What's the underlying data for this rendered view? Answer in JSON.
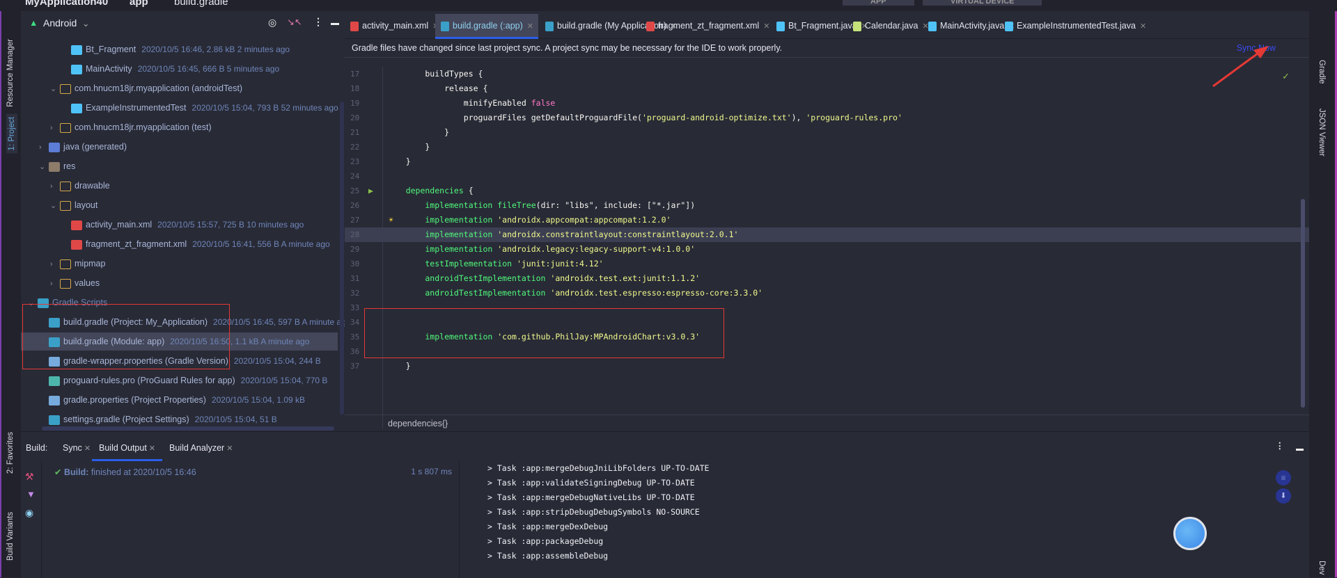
{
  "breadcrumb": [
    "MyApplication40",
    "app",
    "build.gradle"
  ],
  "toolbar": {
    "config": "APP",
    "device": "VIRTUAL DEVICE"
  },
  "left_strip": [
    "Resource Manager",
    "1: Project",
    "2: Favorites",
    "Build Variants"
  ],
  "right_strip": [
    "Gradle",
    "JSON Viewer",
    "Dev"
  ],
  "project": {
    "view": "Android",
    "rows": [
      {
        "level": 4,
        "icon": "java-class",
        "label": "Bt_Fragment",
        "meta": "2020/10/5 16:46, 2.86 kB 2 minutes ago"
      },
      {
        "level": 4,
        "icon": "java-class",
        "label": "MainActivity",
        "meta": "2020/10/5 16:45, 666 B 5 minutes ago"
      },
      {
        "level": 3,
        "arrow": "v",
        "icon": "package",
        "label": "com.hnucm18jr.myapplication (androidTest)",
        "meta": ""
      },
      {
        "level": 4,
        "icon": "test-class",
        "label": "ExampleInstrumentedTest",
        "meta": "2020/10/5 15:04, 793 B 52 minutes ago"
      },
      {
        "level": 3,
        "arrow": ">",
        "icon": "package",
        "label": "com.hnucm18jr.myapplication (test)",
        "meta": ""
      },
      {
        "level": 2,
        "arrow": ">",
        "icon": "generated-folder",
        "label": "java (generated)",
        "meta": ""
      },
      {
        "level": 2,
        "arrow": "v",
        "icon": "res-folder",
        "label": "res",
        "meta": ""
      },
      {
        "level": 3,
        "arrow": ">",
        "icon": "folder",
        "label": "drawable",
        "meta": ""
      },
      {
        "level": 3,
        "arrow": "v",
        "icon": "folder",
        "label": "layout",
        "meta": ""
      },
      {
        "level": 4,
        "icon": "layout-xml",
        "label": "activity_main.xml",
        "meta": "2020/10/5 15:57, 725 B 10 minutes ago"
      },
      {
        "level": 4,
        "icon": "layout-xml",
        "label": "fragment_zt_fragment.xml",
        "meta": "2020/10/5 16:41, 556 B A minute ago"
      },
      {
        "level": 3,
        "arrow": ">",
        "icon": "folder",
        "label": "mipmap",
        "meta": ""
      },
      {
        "level": 3,
        "arrow": ">",
        "icon": "folder",
        "label": "values",
        "meta": ""
      },
      {
        "level": 1,
        "arrow": "v",
        "icon": "gradle",
        "label": "Gradle Scripts",
        "meta": ""
      },
      {
        "level": 2,
        "icon": "gradle",
        "label": "build.gradle (Project: My_Application)",
        "meta": "2020/10/5 16:45, 597 B A minute ago"
      },
      {
        "level": 2,
        "icon": "gradle",
        "label": "build.gradle (Module: app)",
        "meta": "2020/10/5 16:50, 1.1 kB A minute ago",
        "selected": true
      },
      {
        "level": 2,
        "icon": "properties",
        "label": "gradle-wrapper.properties (Gradle Version)",
        "meta": "2020/10/5 15:04, 244 B"
      },
      {
        "level": 2,
        "icon": "proguard",
        "label": "proguard-rules.pro (ProGuard Rules for app)",
        "meta": "2020/10/5 15:04, 770 B"
      },
      {
        "level": 2,
        "icon": "properties",
        "label": "gradle.properties (Project Properties)",
        "meta": "2020/10/5 15:04, 1.09 kB"
      },
      {
        "level": 2,
        "icon": "gradle",
        "label": "settings.gradle (Project Settings)",
        "meta": "2020/10/5 15:04, 51 B"
      }
    ]
  },
  "editor": {
    "tabs": [
      {
        "label": "activity_main.xml",
        "icon": "layout-xml"
      },
      {
        "label": "build.gradle (:app)",
        "icon": "gradle",
        "active": true
      },
      {
        "label": "build.gradle (My Application)",
        "icon": "gradle"
      },
      {
        "label": "fragment_zt_fragment.xml",
        "icon": "layout-xml"
      },
      {
        "label": "Bt_Fragment.java",
        "icon": "java-class"
      },
      {
        "label": "Calendar.java",
        "icon": "java-file"
      },
      {
        "label": "MainActivity.java",
        "icon": "java-class"
      },
      {
        "label": "ExampleInstrumentedTest.java",
        "icon": "test-class"
      }
    ],
    "banner": "Gradle files have changed since last project sync. A project sync may be necessary for the IDE to work properly.",
    "sync_now": "Sync Now",
    "current_line": 28,
    "lines": [
      {
        "n": 17,
        "s": [
          [
            "pl",
            "        buildTypes {"
          ]
        ]
      },
      {
        "n": 18,
        "s": [
          [
            "pl",
            "            release {"
          ]
        ]
      },
      {
        "n": 19,
        "s": [
          [
            "pl",
            "                minifyEnabled "
          ],
          [
            "bool",
            "false"
          ]
        ]
      },
      {
        "n": 20,
        "s": [
          [
            "pl",
            "                proguardFiles getDefaultProguardFile("
          ],
          [
            "str",
            "'proguard-android-optimize.txt'"
          ],
          [
            "pl",
            "), "
          ],
          [
            "str",
            "'proguard-rules.pro'"
          ]
        ]
      },
      {
        "n": 21,
        "s": [
          [
            "pl",
            "            }"
          ]
        ]
      },
      {
        "n": 22,
        "s": [
          [
            "pl",
            "        }"
          ]
        ]
      },
      {
        "n": 23,
        "s": [
          [
            "pl",
            "    }"
          ]
        ]
      },
      {
        "n": 24,
        "s": []
      },
      {
        "n": 25,
        "s": [
          [
            "kw",
            "    dependencies"
          ],
          [
            "pl",
            " {"
          ]
        ]
      },
      {
        "n": 26,
        "s": [
          [
            "kw",
            "        implementation fileTree"
          ],
          [
            "pl",
            "(dir: \"libs\", include: [\"*.jar\"])"
          ]
        ]
      },
      {
        "n": 27,
        "s": [
          [
            "kw",
            "        implementation "
          ],
          [
            "str",
            "'androidx.appcompat:appcompat:1.2.0'"
          ]
        ]
      },
      {
        "n": 28,
        "s": [
          [
            "kw",
            "        implementation "
          ],
          [
            "str",
            "'androidx.constraintlayout:constraintlayout:2.0.1'"
          ]
        ]
      },
      {
        "n": 29,
        "s": [
          [
            "kw",
            "        implementation "
          ],
          [
            "str",
            "'androidx.legacy:legacy-support-v4:1.0.0'"
          ]
        ]
      },
      {
        "n": 30,
        "s": [
          [
            "kw",
            "        testImplementation "
          ],
          [
            "str",
            "'junit:junit:4.12'"
          ]
        ]
      },
      {
        "n": 31,
        "s": [
          [
            "kw",
            "        androidTestImplementation "
          ],
          [
            "str",
            "'androidx.test.ext:junit:1.1.2'"
          ]
        ]
      },
      {
        "n": 32,
        "s": [
          [
            "kw",
            "        androidTestImplementation "
          ],
          [
            "str",
            "'androidx.test.espresso:espresso-core:3.3.0'"
          ]
        ]
      },
      {
        "n": 33,
        "s": []
      },
      {
        "n": 34,
        "s": []
      },
      {
        "n": 35,
        "s": [
          [
            "kw",
            "        implementation "
          ],
          [
            "str",
            "'com.github.PhilJay:MPAndroidChart:v3.0.3'"
          ]
        ]
      },
      {
        "n": 36,
        "s": []
      },
      {
        "n": 37,
        "s": [
          [
            "pl",
            "    }"
          ]
        ]
      }
    ],
    "breadcrumb": "dependencies{}"
  },
  "build": {
    "label": "Build:",
    "tabs": [
      {
        "label": "Sync"
      },
      {
        "label": "Build Output",
        "active": true
      },
      {
        "label": "Build Analyzer"
      }
    ],
    "status_bold": "Build:",
    "status": "finished at 2020/10/5 16:46",
    "duration": "1 s 807 ms",
    "tasks": [
      "> Task :app:mergeDebugJniLibFolders UP-TO-DATE",
      "> Task :app:validateSigningDebug UP-TO-DATE",
      "> Task :app:mergeDebugNativeLibs UP-TO-DATE",
      "> Task :app:stripDebugDebugSymbols NO-SOURCE",
      "> Task :app:mergeDexDebug",
      "> Task :app:packageDebug",
      "> Task :app:assembleDebug"
    ]
  },
  "colors": {
    "accent": "#2b5ee8",
    "annotation": "#e53935",
    "sync_link": "#3c4cf0",
    "success": "#5fb85f"
  }
}
